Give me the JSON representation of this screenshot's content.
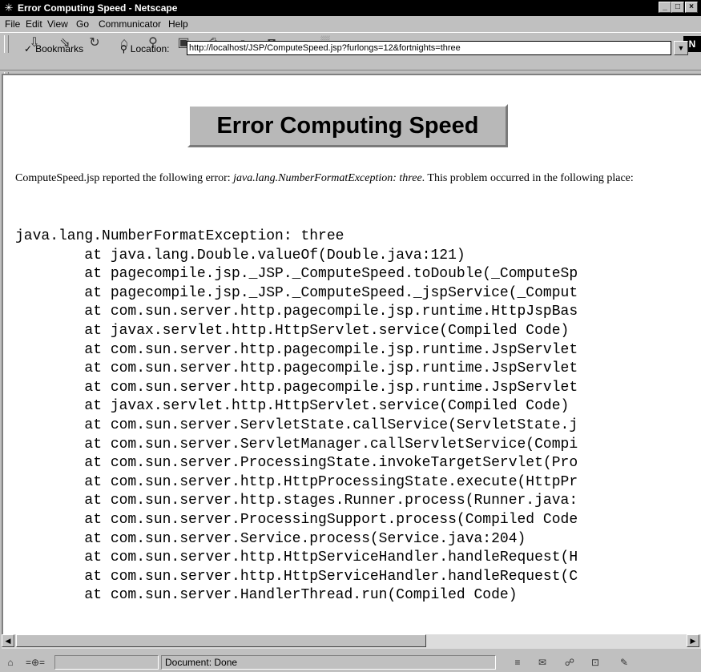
{
  "window": {
    "title": "Error Computing Speed - Netscape",
    "controls": {
      "minimize": "_",
      "maximize": "□",
      "close": "×"
    }
  },
  "menu": [
    "File",
    "Edit",
    "View",
    "Go",
    "Communicator",
    "Help"
  ],
  "toolbar": {
    "buttons": [
      "back-icon",
      "forward-icon",
      "reload-icon",
      "home-icon",
      "search-icon",
      "my-netscape-icon",
      "print-icon",
      "security-icon",
      "shop-icon",
      "stop-icon"
    ],
    "logo": "N"
  },
  "location_bar": {
    "bookmarks_label": "Bookmarks",
    "location_label": "Location:",
    "url": "http://localhost/JSP/ComputeSpeed.jsp?furlongs=12&fortnights=three"
  },
  "page": {
    "heading": "Error Computing Speed",
    "intro_prefix": "ComputeSpeed.jsp reported the following error: ",
    "error_text": "java.lang.NumberFormatException: three",
    "intro_suffix": ". This problem occurred in the following place:",
    "stack_trace": [
      "java.lang.NumberFormatException: three",
      "        at java.lang.Double.valueOf(Double.java:121)",
      "        at pagecompile.jsp._JSP._ComputeSpeed.toDouble(_ComputeSp",
      "        at pagecompile.jsp._JSP._ComputeSpeed._jspService(_Comput",
      "        at com.sun.server.http.pagecompile.jsp.runtime.HttpJspBas",
      "        at javax.servlet.http.HttpServlet.service(Compiled Code)",
      "        at com.sun.server.http.pagecompile.jsp.runtime.JspServlet",
      "        at com.sun.server.http.pagecompile.jsp.runtime.JspServlet",
      "        at com.sun.server.http.pagecompile.jsp.runtime.JspServlet",
      "        at javax.servlet.http.HttpServlet.service(Compiled Code)",
      "        at com.sun.server.ServletState.callService(ServletState.j",
      "        at com.sun.server.ServletManager.callServletService(Compi",
      "        at com.sun.server.ProcessingState.invokeTargetServlet(Pro",
      "        at com.sun.server.http.HttpProcessingState.execute(HttpPr",
      "        at com.sun.server.http.stages.Runner.process(Runner.java:",
      "        at com.sun.server.ProcessingSupport.process(Compiled Code",
      "        at com.sun.server.Service.process(Service.java:204)",
      "        at com.sun.server.http.HttpServiceHandler.handleRequest(H",
      "        at com.sun.server.http.HttpServiceHandler.handleRequest(C",
      "        at com.sun.server.HandlerThread.run(Compiled Code)"
    ]
  },
  "status": {
    "text": "Document: Done"
  }
}
